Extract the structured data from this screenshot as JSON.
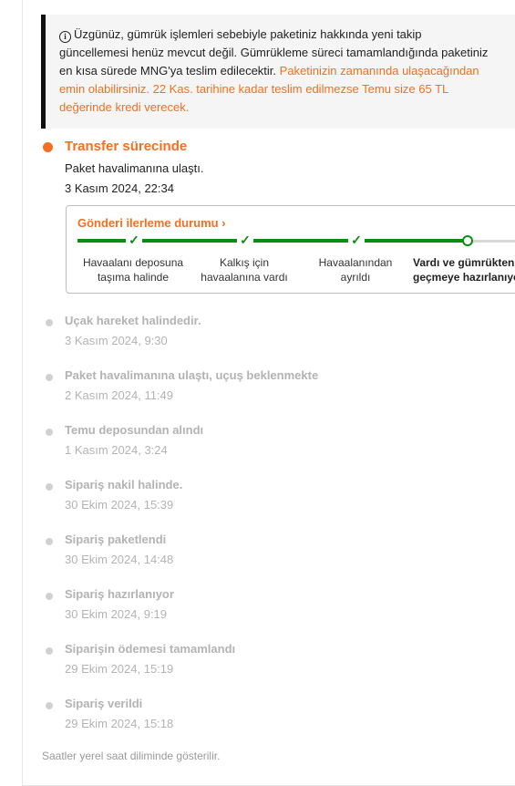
{
  "notice": {
    "line1": "Üzgünüz, gümrük işlemleri sebebiyle paketiniz hakkında yeni takip",
    "line2": "güncellemesi henüz mevcut değil. Gümrükleme süreci tamamlandığında paketiniz",
    "line3_plain": "en kısa sürede MNG'ya teslim edilecektir.",
    "line3_orange": "Paketinizin zamanında ulaşacağından",
    "line4": "emin olabilirsiniz. 22 Kas. tarihine kadar teslim edilmezse Temu size 65 TL",
    "line5": "değerinde kredi verecek."
  },
  "current_status": {
    "title": "Transfer sürecinde",
    "description": "Paket havalimanına ulaştı.",
    "time": "3 Kasım 2024, 22:34"
  },
  "progress": {
    "title": "Gönderi ilerleme durumu",
    "stages": [
      {
        "line1": "Havaalanı deposuna",
        "line2": "taşıma halinde"
      },
      {
        "line1": "Kalkış için",
        "line2": "havaalanına vardı"
      },
      {
        "line1": "Havaalanından",
        "line2": "ayrıldı"
      },
      {
        "line1": "Vardı ve gümrükten",
        "line2": "geçmeye hazırlanıyor"
      }
    ]
  },
  "history": [
    {
      "title": "Uçak hareket halindedir.",
      "time": "3 Kasım 2024, 9:30"
    },
    {
      "title": "Paket havalimanına ulaştı, uçuş beklenmekte",
      "time": "2 Kasım 2024, 11:49"
    },
    {
      "title": "Temu deposundan alındı",
      "time": "1 Kasım 2024, 3:24"
    },
    {
      "title": "Sipariş nakil halinde.",
      "time": "30 Ekim 2024, 15:39"
    },
    {
      "title": "Sipariş paketlendi",
      "time": "30 Ekim 2024, 14:48"
    },
    {
      "title": "Sipariş hazırlanıyor",
      "time": "30 Ekim 2024, 9:19"
    },
    {
      "title": "Siparişin ödemesi tamamlandı",
      "time": "29 Ekim 2024, 15:19"
    },
    {
      "title": "Sipariş verildi",
      "time": "29 Ekim 2024, 15:18"
    }
  ],
  "footer": "Saatler yerel saat diliminde gösterilir.",
  "colors": {
    "accent": "#f36f21",
    "progress_green": "#0a8e12",
    "muted": "#b3b3b3"
  },
  "icons": {
    "info": "info-circle-icon",
    "chevron": "chevron-right-icon",
    "check": "check-icon"
  }
}
